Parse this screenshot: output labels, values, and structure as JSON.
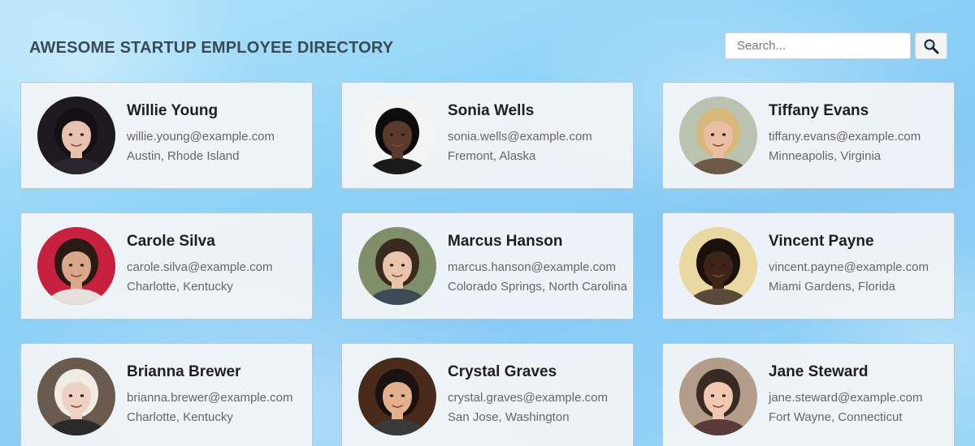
{
  "header": {
    "title": "AWESOME STARTUP EMPLOYEE DIRECTORY"
  },
  "search": {
    "placeholder": "Search...",
    "button_icon": "search-icon"
  },
  "employees": [
    {
      "name": "Willie Young",
      "email": "willie.young@example.com",
      "city": "Austin, Rhode Island",
      "bg": "#1f1a22",
      "skin": "#e8c2b0",
      "hair": "#141016",
      "shirt": "#2b2530"
    },
    {
      "name": "Sonia Wells",
      "email": "sonia.wells@example.com",
      "city": "Fremont, Alaska",
      "bg": "#f4f4f4",
      "skin": "#5a3a2a",
      "hair": "#0d0b0b",
      "shirt": "#1a1a1a"
    },
    {
      "name": "Tiffany Evans",
      "email": "tiffany.evans@example.com",
      "city": "Minneapolis, Virginia",
      "bg": "#b9c3b0",
      "skin": "#e9bfa3",
      "hair": "#d8b878",
      "shirt": "#6b5a48"
    },
    {
      "name": "Carole Silva",
      "email": "carole.silva@example.com",
      "city": "Charlotte, Kentucky",
      "bg": "#c8213f",
      "skin": "#d9a88a",
      "hair": "#2a1a14",
      "shirt": "#e6e0dc"
    },
    {
      "name": "Marcus Hanson",
      "email": "marcus.hanson@example.com",
      "city": "Colorado Springs, North Carolina",
      "bg": "#7f8f6a",
      "skin": "#eac4aa",
      "hair": "#3a2a1e",
      "shirt": "#3d4a58"
    },
    {
      "name": "Vincent Payne",
      "email": "vincent.payne@example.com",
      "city": "Miami Gardens, Florida",
      "bg": "#e9d9a0",
      "skin": "#3d2418",
      "hair": "#1b110c",
      "shirt": "#5a4a3a"
    },
    {
      "name": "Brianna Brewer",
      "email": "brianna.brewer@example.com",
      "city": "Charlotte, Kentucky",
      "bg": "#6a5a4e",
      "skin": "#ecd1c4",
      "hair": "#f1ece2",
      "shirt": "#2a2a2a"
    },
    {
      "name": "Crystal Graves",
      "email": "crystal.graves@example.com",
      "city": "San Jose, Washington",
      "bg": "#4a2a1a",
      "skin": "#e3b08e",
      "hair": "#1a1210",
      "shirt": "#3a3a3a"
    },
    {
      "name": "Jane Steward",
      "email": "jane.steward@example.com",
      "city": "Fort Wayne, Connecticut",
      "bg": "#b49c8a",
      "skin": "#f0c8b0",
      "hair": "#3a2a24",
      "shirt": "#5a3a3a"
    }
  ]
}
